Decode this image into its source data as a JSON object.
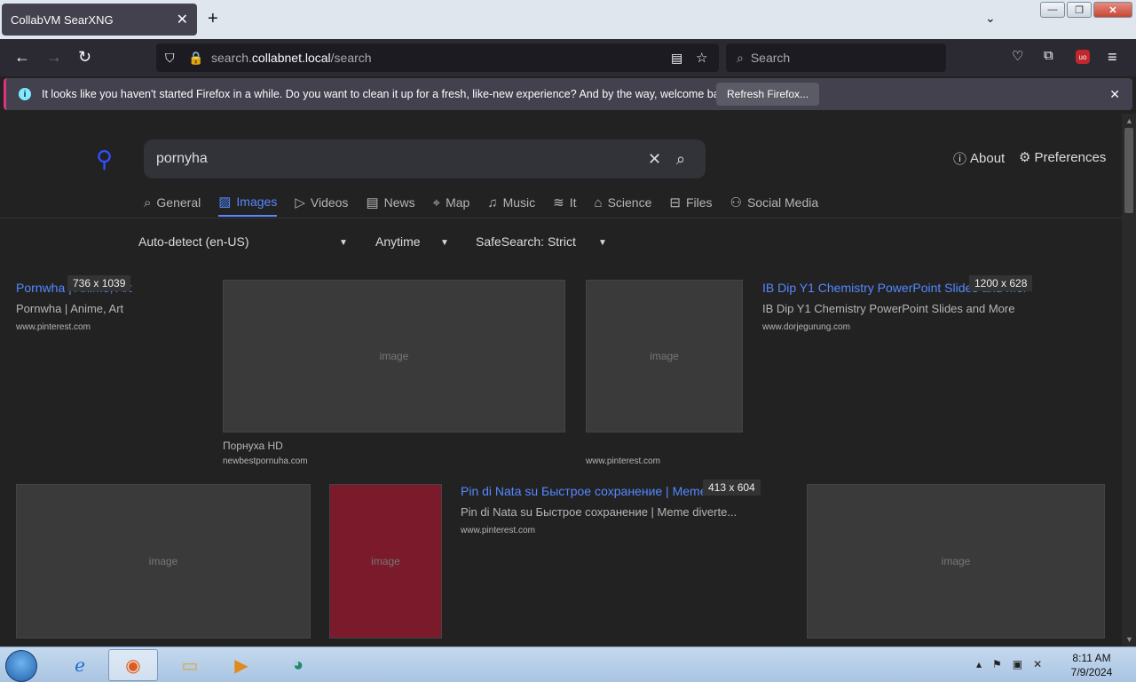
{
  "browser": {
    "tab_title": "CollabVM SearXNG",
    "url_prefix": "search.",
    "url_domain": "collabnet.local",
    "url_path": "/search",
    "search_placeholder": "Search"
  },
  "notification": {
    "message": "It looks like you haven't started Firefox in a while. Do you want to clean it up for a fresh, like-new experience? And by the way, welcome back!",
    "button": "Refresh Firefox..."
  },
  "search": {
    "query": "pornyha",
    "about": "About",
    "preferences": "Preferences"
  },
  "categories": [
    {
      "label": "General",
      "icon": "search-icon"
    },
    {
      "label": "Images",
      "icon": "image-icon"
    },
    {
      "label": "Videos",
      "icon": "play-icon"
    },
    {
      "label": "News",
      "icon": "newspaper-icon"
    },
    {
      "label": "Map",
      "icon": "pin-icon"
    },
    {
      "label": "Music",
      "icon": "music-icon"
    },
    {
      "label": "It",
      "icon": "layers-icon"
    },
    {
      "label": "Science",
      "icon": "cap-icon"
    },
    {
      "label": "Files",
      "icon": "archive-icon"
    },
    {
      "label": "Social Media",
      "icon": "people-icon"
    }
  ],
  "filters": {
    "language": "Auto-detect (en-US)",
    "time": "Anytime",
    "safesearch": "SafeSearch: Strict"
  },
  "results": [
    {
      "title": "Pornwha | Anime, Art",
      "dims": "736 x 1039",
      "content": "Pornwha | Anime, Art",
      "url": "www.pinterest.com"
    },
    {
      "caption": "Порнуха HD",
      "url": "newbestpornuha.com"
    },
    {
      "url": "www.pinterest.com"
    },
    {
      "title": "IB Dip Y1 Chemistry PowerPoint Slides and More",
      "dims": "1200 x 628",
      "content": "IB Dip Y1 Chemistry PowerPoint Slides and More",
      "url": "www.dorjegurung.com"
    },
    {
      "title": "Pin di Nata su Быстрое сохранение | Meme divertenti",
      "dims": "413 x 604",
      "content": "Pin di Nata su Быстрое сохранение | Meme diverte...",
      "url": "www.pinterest.com"
    }
  ],
  "thumb_placeholder": "image",
  "taskbar": {
    "time": "8:11 AM",
    "date": "7/9/2024"
  }
}
